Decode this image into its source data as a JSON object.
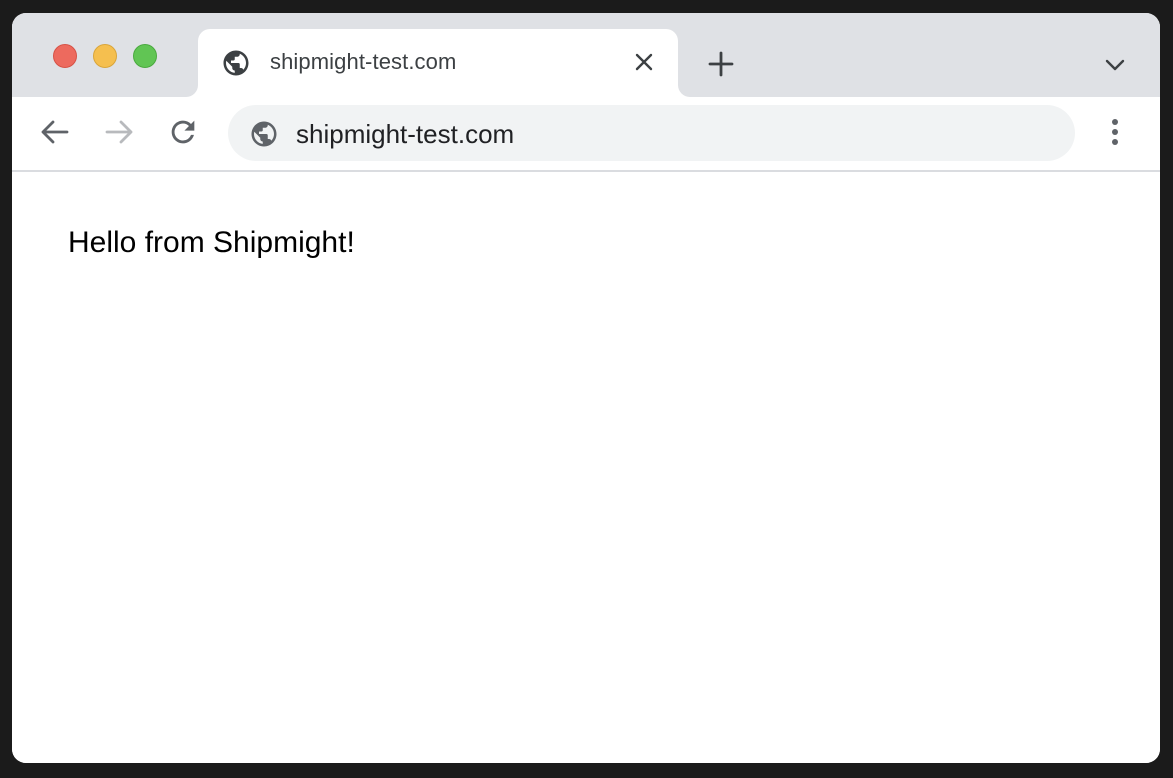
{
  "window": {
    "traffic_lights": [
      {
        "name": "close",
        "color": "#ed6a5e"
      },
      {
        "name": "minimize",
        "color": "#f5bf4f"
      },
      {
        "name": "maximize",
        "color": "#61c554"
      }
    ]
  },
  "tab": {
    "icon": "globe-icon",
    "title": "shipmight-test.com",
    "close_icon": "close-icon"
  },
  "tabstrip": {
    "new_tab_icon": "plus-icon",
    "tab_search_icon": "chevron-down-icon"
  },
  "toolbar": {
    "back_icon": "arrow-left-icon",
    "forward_icon": "arrow-right-icon",
    "reload_icon": "reload-icon",
    "menu_icon": "kebab-menu-icon"
  },
  "omnibox": {
    "icon": "globe-icon",
    "url": "shipmight-test.com"
  },
  "page": {
    "text": "Hello from Shipmight!"
  },
  "colors": {
    "tabstrip_bg": "#dfe1e5",
    "omnibox_bg": "#f1f3f4",
    "icon_dark": "#5f6368",
    "icon_disabled": "#b8babd"
  }
}
